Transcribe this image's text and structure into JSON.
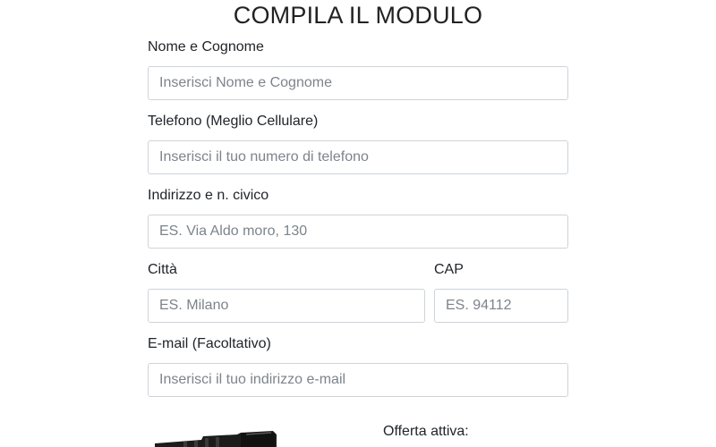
{
  "form": {
    "title": "COMPILA IL MODULO",
    "name": {
      "label": "Nome e Cognome",
      "placeholder": "Inserisci Nome e Cognome"
    },
    "phone": {
      "label": "Telefono (Meglio Cellulare)",
      "placeholder": "Inserisci il tuo numero di telefono"
    },
    "address": {
      "label": "Indirizzo e n. civico",
      "placeholder": "ES. Via Aldo moro, 130"
    },
    "city": {
      "label": "Città",
      "placeholder": "ES. Milano"
    },
    "cap": {
      "label": "CAP",
      "placeholder": "ES. 94112"
    },
    "email": {
      "label": "E-mail (Facoltativo)",
      "placeholder": "Inserisci il tuo indirizzo e-mail"
    }
  },
  "offer": {
    "label": "Offerta attiva:",
    "product_icon": "flashlight-product-image"
  },
  "colors": {
    "input_border": "#ced4da",
    "text": "#212529",
    "placeholder": "#7c848c"
  }
}
